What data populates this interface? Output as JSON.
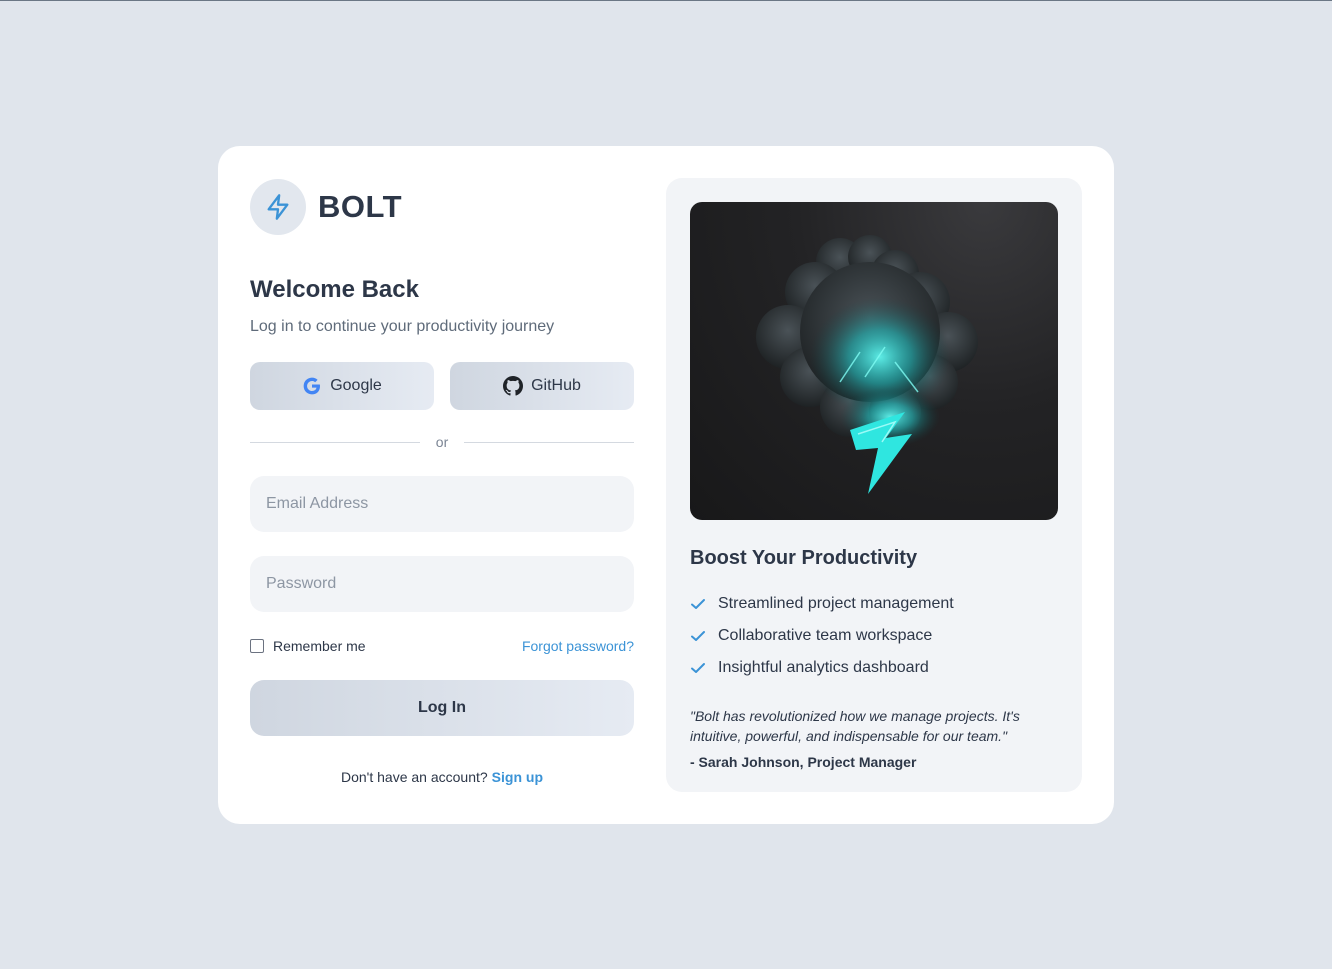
{
  "brand": {
    "name": "BOLT",
    "accent": "#3b93d6"
  },
  "login": {
    "heading": "Welcome Back",
    "subtitle": "Log in to continue your productivity journey",
    "social": {
      "google_label": "Google",
      "github_label": "GitHub"
    },
    "divider_text": "or",
    "email_placeholder": "Email Address",
    "password_placeholder": "Password",
    "remember_label": "Remember me",
    "remember_checked": false,
    "forgot_label": "Forgot password?",
    "submit_label": "Log In",
    "signup_prompt": "Don't have an account?",
    "signup_link": "Sign up"
  },
  "promo": {
    "heading": "Boost Your Productivity",
    "features": [
      "Streamlined project management",
      "Collaborative team workspace",
      "Insightful analytics dashboard"
    ],
    "quote": "\"Bolt has revolutionized how we manage projects. It's intuitive, powerful, and indispensable for our team.\"",
    "author": "- Sarah Johnson, Project Manager"
  },
  "icons": {
    "brand": "lightning-icon",
    "google": "google-icon",
    "github": "github-icon",
    "check": "check-icon",
    "hero": "storm-cloud-lightning-image"
  }
}
